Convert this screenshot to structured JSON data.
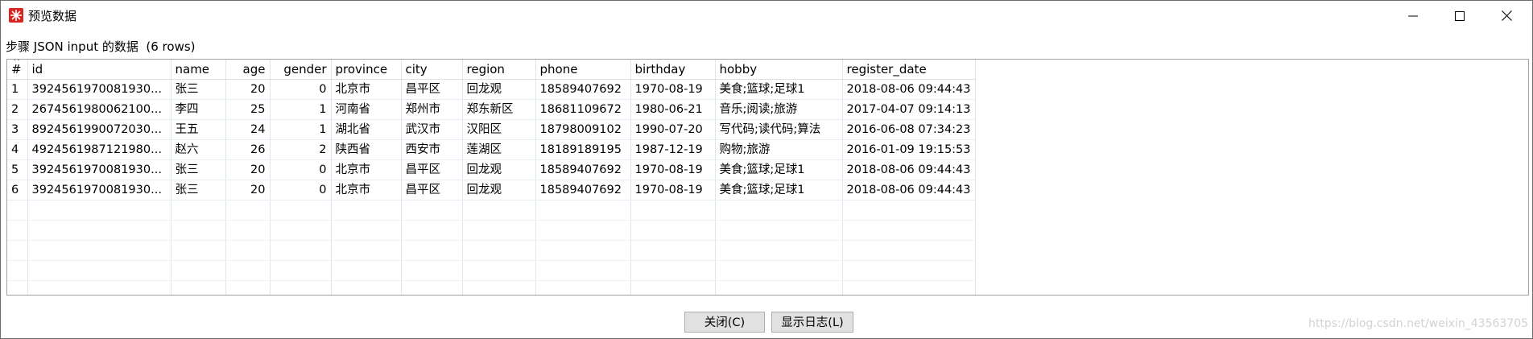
{
  "window": {
    "title": "预览数据"
  },
  "caption": "步骤 JSON input 的数据  (6 rows)",
  "table": {
    "sort_indicator": "^",
    "headers": [
      "#",
      "id",
      "name",
      "age",
      "gender",
      "province",
      "city",
      "region",
      "phone",
      "birthday",
      "hobby",
      "register_date"
    ],
    "rows": [
      [
        "1",
        "3924561970081930...",
        "张三",
        "20",
        "0",
        "北京市",
        "昌平区",
        "回龙观",
        "18589407692",
        "1970-08-19",
        "美食;篮球;足球1",
        "2018-08-06 09:44:43"
      ],
      [
        "2",
        "2674561980062100...",
        "李四",
        "25",
        "1",
        "河南省",
        "郑州市",
        "郑东新区",
        "18681109672",
        "1980-06-21",
        "音乐;阅读;旅游",
        "2017-04-07 09:14:13"
      ],
      [
        "3",
        "8924561990072030...",
        "王五",
        "24",
        "1",
        "湖北省",
        "武汉市",
        "汉阳区",
        "18798009102",
        "1990-07-20",
        "写代码;读代码;算法",
        "2016-06-08 07:34:23"
      ],
      [
        "4",
        "4924561987121980...",
        "赵六",
        "26",
        "2",
        "陕西省",
        "西安市",
        "莲湖区",
        "18189189195",
        "1987-12-19",
        "购物;旅游",
        "2016-01-09 19:15:53"
      ],
      [
        "5",
        "3924561970081930...",
        "张三",
        "20",
        "0",
        "北京市",
        "昌平区",
        "回龙观",
        "18589407692",
        "1970-08-19",
        "美食;篮球;足球1",
        "2018-08-06 09:44:43"
      ],
      [
        "6",
        "3924561970081930...",
        "张三",
        "20",
        "0",
        "北京市",
        "昌平区",
        "回龙观",
        "18589407692",
        "1970-08-19",
        "美食;篮球;足球1",
        "2018-08-06 09:44:43"
      ]
    ]
  },
  "buttons": {
    "close": "关闭(C)",
    "show_log": "显示日志(L)"
  },
  "watermark": "https://blog.csdn.net/weixin_43563705"
}
